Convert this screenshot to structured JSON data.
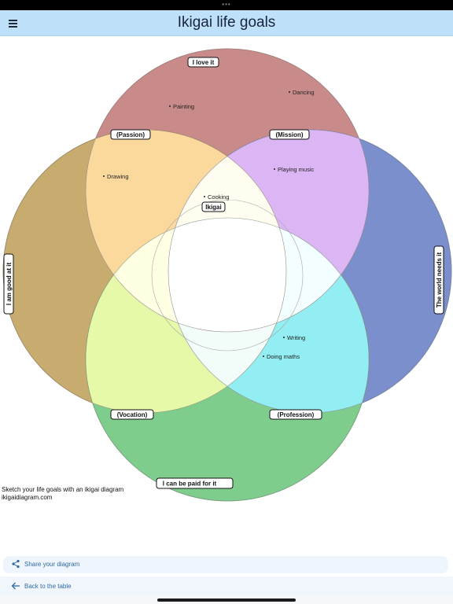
{
  "status_bar": {
    "indicator": "•••"
  },
  "header": {
    "title": "Ikigai life goals",
    "menu_icon": "hamburger-menu-icon"
  },
  "diagram": {
    "circles": [
      {
        "id": "love",
        "label": "I love it",
        "color": "#b85c5c"
      },
      {
        "id": "good",
        "label": "I am good at it",
        "color": "#b58e34"
      },
      {
        "id": "world",
        "label": "The world needs it",
        "color": "#3f5bb5"
      },
      {
        "id": "paid",
        "label": "I can be paid for it",
        "color": "#2fa846"
      }
    ],
    "intersections": {
      "passion": "(Passion)",
      "mission": "(Mission)",
      "vocation": "(Vocation)",
      "profession": "(Profession)",
      "ikigai": "Ikigai"
    },
    "items": {
      "dancing": "Dancing",
      "painting": "Painting",
      "drawing": "Drawing",
      "playing_music": "Playing music",
      "cooking": "Cooking",
      "writing": "Writing",
      "doing_maths": "Doing maths"
    }
  },
  "caption": {
    "line1": "Sketch your life goals with an ikigai diagram",
    "line2": "ikigaidiagram.com"
  },
  "actions": {
    "share": "Share your diagram",
    "back": "Back to the table"
  }
}
